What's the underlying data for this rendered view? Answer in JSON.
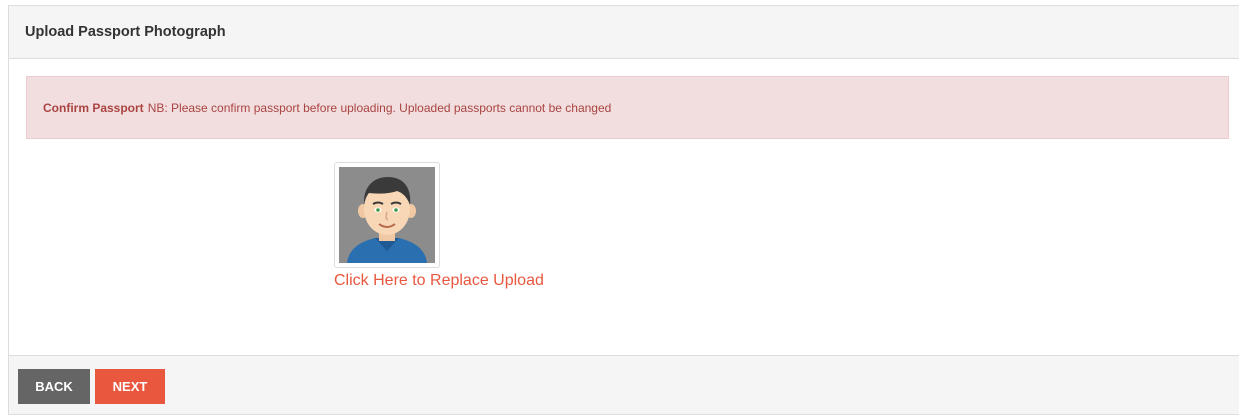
{
  "panel": {
    "title": "Upload Passport Photograph"
  },
  "alert": {
    "heading": "Confirm Passport",
    "message": "NB: Please confirm passport before uploading. Uploaded passports cannot be changed"
  },
  "photo": {
    "icon": "avatar-icon",
    "replace_label": "Click Here to Replace Upload"
  },
  "footer": {
    "back_label": "BACK",
    "next_label": "NEXT"
  },
  "colors": {
    "accent": "#e9573f",
    "alert_bg": "#f2dede",
    "alert_text": "#a94442",
    "back_button": "#656565"
  }
}
